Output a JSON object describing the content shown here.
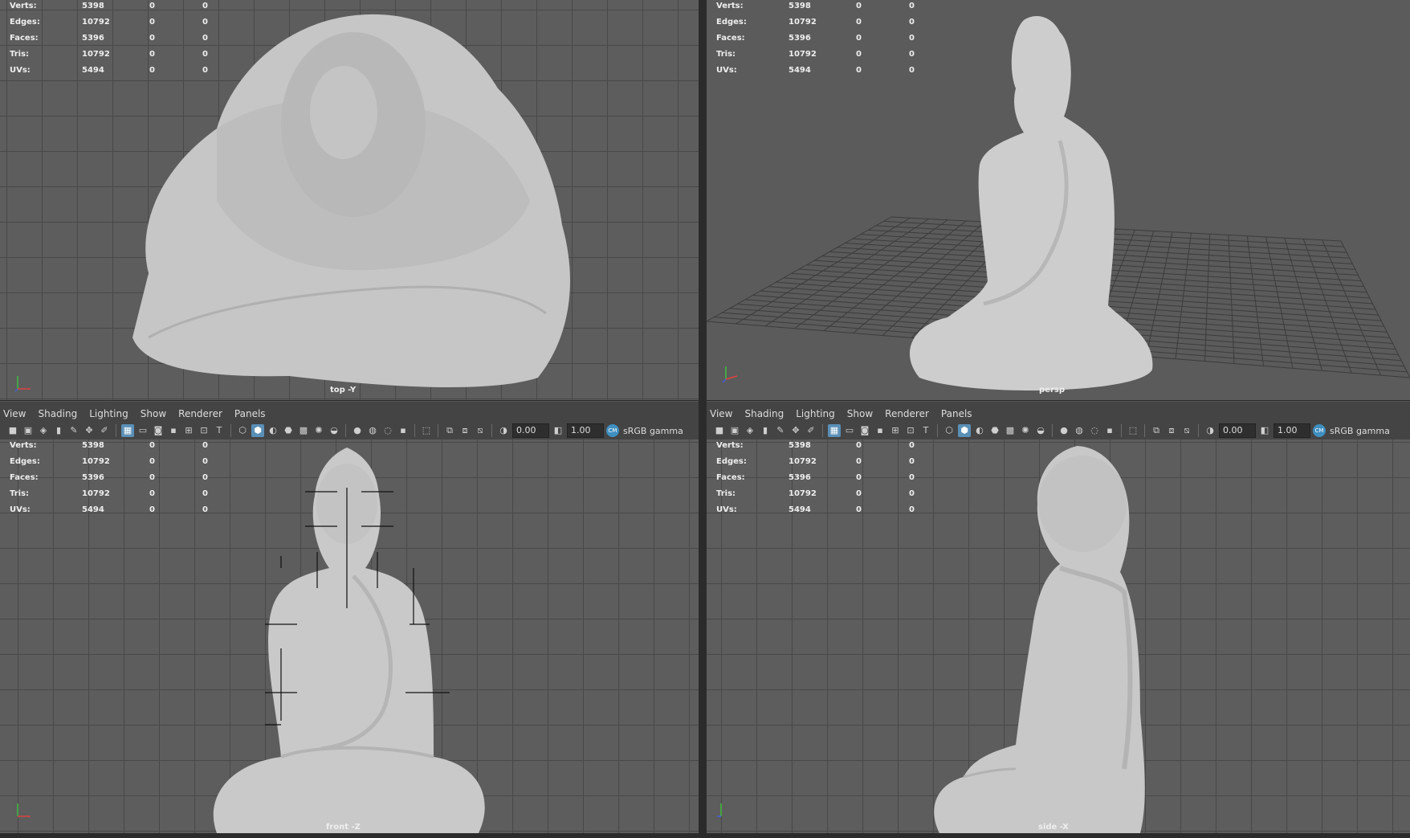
{
  "stats": [
    {
      "label": "Verts:",
      "value": "5398",
      "a": "0",
      "b": "0"
    },
    {
      "label": "Edges:",
      "value": "10792",
      "a": "0",
      "b": "0"
    },
    {
      "label": "Faces:",
      "value": "5396",
      "a": "0",
      "b": "0"
    },
    {
      "label": "Tris:",
      "value": "10792",
      "a": "0",
      "b": "0"
    },
    {
      "label": "UVs:",
      "value": "5494",
      "a": "0",
      "b": "0"
    }
  ],
  "cameras": {
    "top": "top -Y",
    "persp": "persp",
    "front": "front -Z",
    "side": "side -X"
  },
  "menus": [
    "View",
    "Shading",
    "Lighting",
    "Show",
    "Renderer",
    "Panels"
  ],
  "toolbar": {
    "exposure": "0.00",
    "gamma": "1.00",
    "color_space": "sRGB gamma"
  }
}
